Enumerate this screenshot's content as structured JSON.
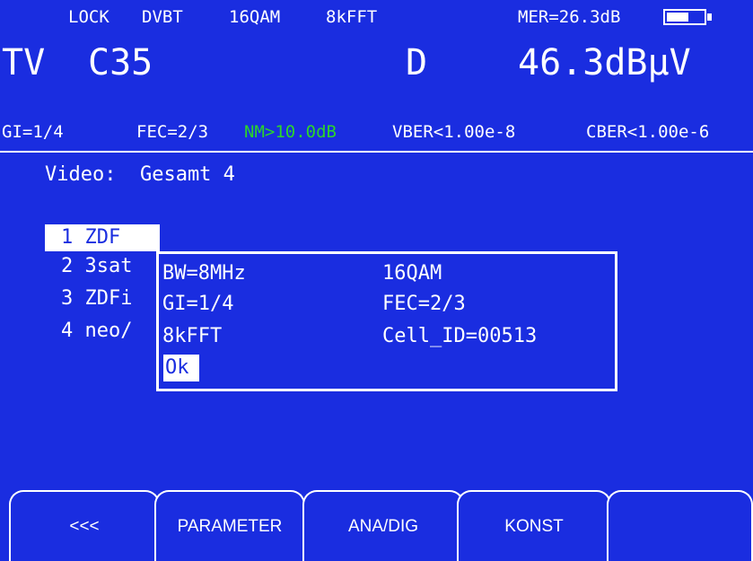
{
  "status": {
    "lock": "LOCK",
    "standard": "DVBT",
    "modulation": "16QAM",
    "fft": "8kFFT",
    "mer": "MER=26.3dB",
    "battery_level": 0.6
  },
  "main": {
    "band": "TV",
    "channel": "C35",
    "mode": "D",
    "level": "46.3dBµV"
  },
  "params": {
    "gi": "GI=1/4",
    "fec": "FEC=2/3",
    "nm": "NM>10.0dB",
    "vber": "VBER<1.00e-8",
    "cber": "CBER<1.00e-6"
  },
  "colors": {
    "background": "#1a2de0",
    "foreground": "#ffffff",
    "nm_green": "#2bd42b"
  },
  "list": {
    "header": "Video:  Gesamt 4",
    "items": [
      {
        "label": "1 ZDF"
      },
      {
        "label": "2 3sat"
      },
      {
        "label": "3 ZDFi"
      },
      {
        "label": "4 neo/"
      }
    ]
  },
  "dialog": {
    "bw": "BW=8MHz",
    "modulation": "16QAM",
    "gi": "GI=1/4",
    "fec": "FEC=2/3",
    "fft": "8kFFT",
    "cell_id": "Cell_ID=00513",
    "ok_label": "Ok"
  },
  "softkeys": {
    "back": "<<<",
    "parameter": "PARAMETER",
    "ana_dig": "ANA/DIG",
    "konst": "KONST",
    "empty": ""
  }
}
